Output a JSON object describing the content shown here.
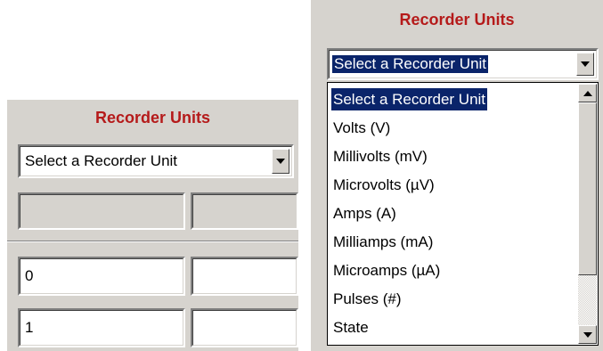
{
  "left_panel": {
    "heading": "Recorder Units",
    "combo": {
      "value": "Select a Recorder Unit"
    },
    "rows": [
      {
        "left": "",
        "right": ""
      },
      {
        "left": "0",
        "right": ""
      },
      {
        "left": "1",
        "right": ""
      }
    ]
  },
  "right_panel": {
    "heading": "Recorder Units",
    "combo": {
      "value": "Select a Recorder Unit"
    },
    "options": [
      "Select a Recorder Unit",
      "Volts (V)",
      "Millivolts (mV)",
      "Microvolts (µV)",
      "Amps (A)",
      "Milliamps (mA)",
      "Microamps (µA)",
      "Pulses (#)",
      "State"
    ],
    "selected_index": 0
  },
  "colors": {
    "heading": "#b51a1a",
    "selection": "#0a246a",
    "face": "#d6d3ce"
  },
  "icons": {
    "combo_button": "chevron-down-icon",
    "scroll_up": "scroll-up-icon",
    "scroll_down": "scroll-down-icon"
  }
}
